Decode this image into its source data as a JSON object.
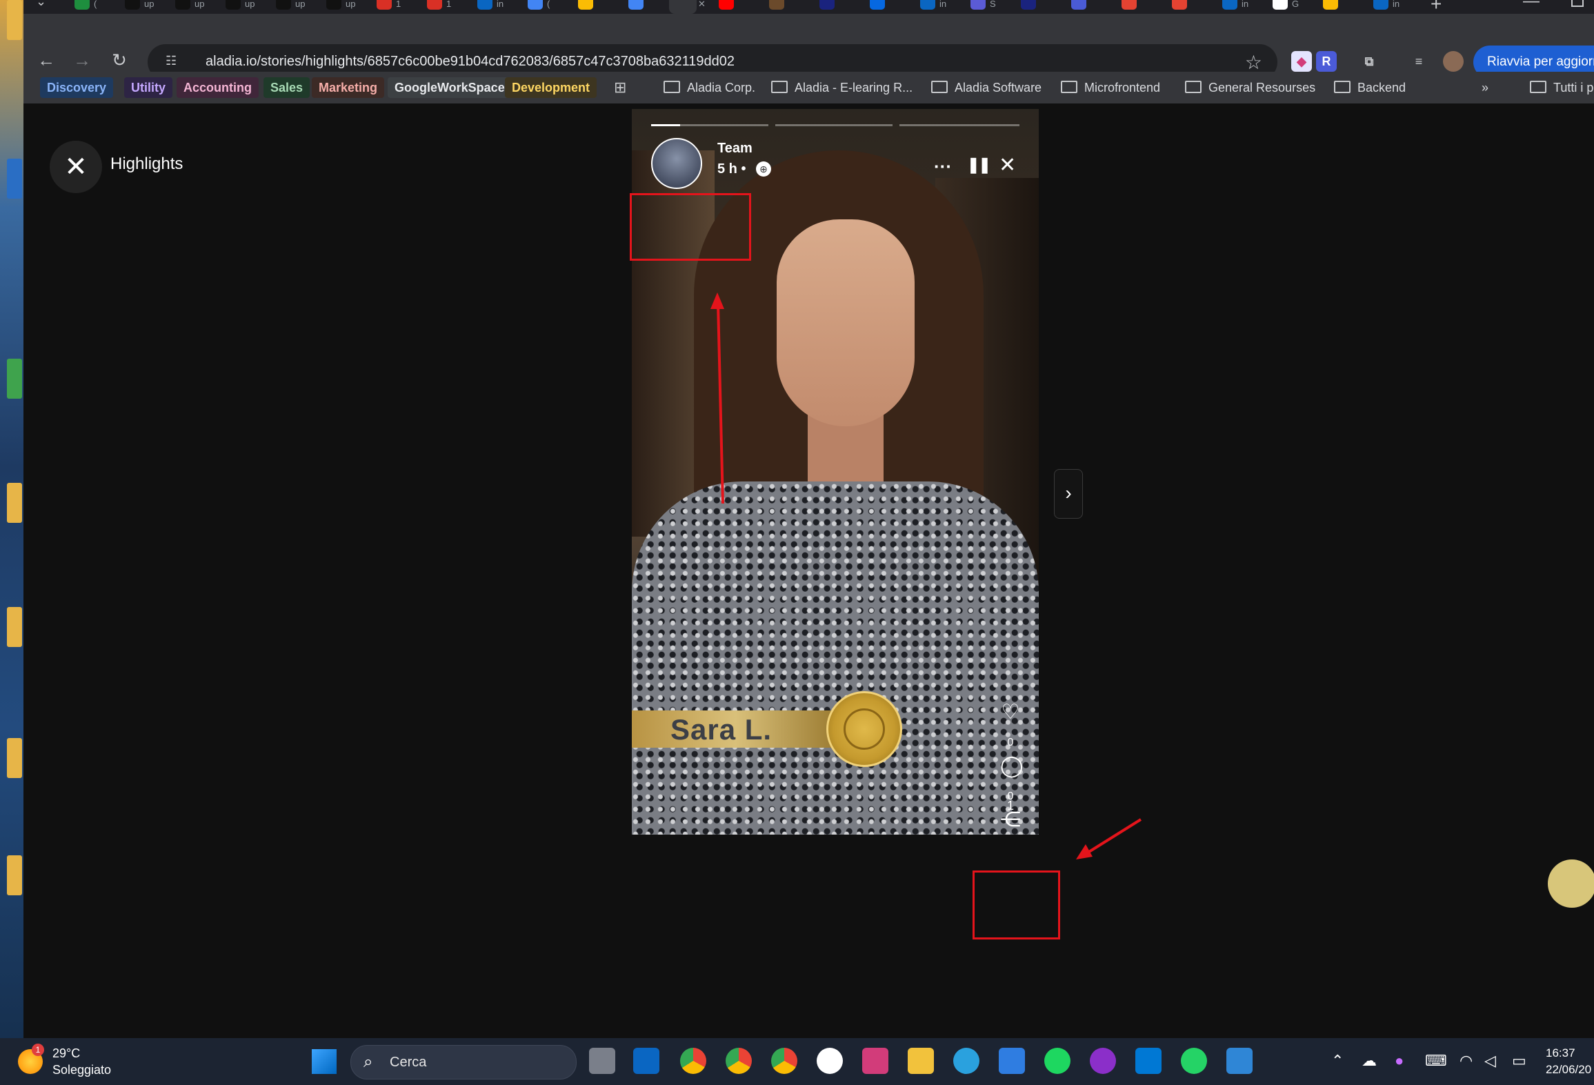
{
  "browser": {
    "url": "aladia.io/stories/highlights/6857c6c00be91b04cd762083/6857c47c3708ba632119dd02",
    "update_button": "Riavvia per aggiorn",
    "tabs": [
      {
        "icon": "google-meet-icon",
        "title": "(",
        "color": "#1e8e3e"
      },
      {
        "icon": "upwork-icon",
        "title": "up",
        "color": "#111111"
      },
      {
        "icon": "upwork-icon",
        "title": "up",
        "color": "#111111"
      },
      {
        "icon": "upwork-icon",
        "title": "up",
        "color": "#111111"
      },
      {
        "icon": "upwork-icon",
        "title": "up",
        "color": "#111111"
      },
      {
        "icon": "upwork-icon",
        "title": "up",
        "color": "#111111"
      },
      {
        "icon": "gmail-icon",
        "title": "1",
        "color": "#d93025"
      },
      {
        "icon": "gmail-icon",
        "title": "1",
        "color": "#d93025"
      },
      {
        "icon": "linkedin-icon",
        "title": "in",
        "color": "#0a66c2"
      },
      {
        "icon": "gemini-icon",
        "title": "(",
        "color": "#4285f4"
      },
      {
        "icon": "google-drive-icon",
        "title": "",
        "color": "#fbbc04"
      },
      {
        "icon": "google-docs-icon",
        "title": "",
        "color": "#4285f4"
      },
      {
        "icon": "active-tab-close-icon",
        "title": "✕",
        "color": "#35363a"
      },
      {
        "icon": "youtube-icon",
        "title": "",
        "color": "#ff0000"
      },
      {
        "icon": "site-icon",
        "title": "",
        "color": "#6b4a2b"
      },
      {
        "icon": "tab-icon",
        "title": "",
        "color": "#1a237e"
      },
      {
        "icon": "meta-icon",
        "title": "",
        "color": "#0668e1"
      },
      {
        "icon": "linkedin-icon",
        "title": "in",
        "color": "#0a66c2"
      },
      {
        "icon": "s-icon",
        "title": "S",
        "color": "#5b5bd6"
      },
      {
        "icon": "tab-icon",
        "title": "",
        "color": "#1a237e"
      },
      {
        "icon": "compass-icon",
        "title": "",
        "color": "#4a5bd6"
      },
      {
        "icon": "todoist-icon",
        "title": "",
        "color": "#e44332"
      },
      {
        "icon": "todoist-icon",
        "title": "",
        "color": "#e44332"
      },
      {
        "icon": "linkedin-icon",
        "title": "in",
        "color": "#0a66c2"
      },
      {
        "icon": "google-icon",
        "title": "G",
        "color": "#ffffff"
      },
      {
        "icon": "google-drive-icon",
        "title": "",
        "color": "#fbbc04"
      },
      {
        "icon": "linkedin-icon",
        "title": "in",
        "color": "#0a66c2"
      }
    ],
    "bookmark_chips": [
      {
        "label": "Discovery",
        "bg": "#1e3a5f",
        "fg": "#8ab4f8"
      },
      {
        "label": "Utility",
        "bg": "#2d2444",
        "fg": "#c5a8ff"
      },
      {
        "label": "Accounting",
        "bg": "#40263a",
        "fg": "#f4b5d4"
      },
      {
        "label": "Sales",
        "bg": "#1f3a2a",
        "fg": "#a8dab5"
      },
      {
        "label": "Marketing",
        "bg": "#3c2a26",
        "fg": "#f6aea9"
      },
      {
        "label": "GoogleWorkSpace",
        "bg": "#3c4043",
        "fg": "#e8eaed"
      },
      {
        "label": "Development",
        "bg": "#3d3520",
        "fg": "#fdd663"
      }
    ],
    "bookmark_folders": [
      "Aladia Corp.",
      "Aladia - E-learing R...",
      "Aladia Software",
      "Microfrontend",
      "General Resourses",
      "Backend"
    ],
    "all_bookmarks": "Tutti i p",
    "overflow": "»"
  },
  "page": {
    "title": "Highlights"
  },
  "story": {
    "user": "Team",
    "time": "5 h •",
    "name_caption": "Sara L.",
    "likes": "0",
    "comments": "0",
    "shares": "0",
    "index": "1"
  },
  "taskbar": {
    "temp": "29°C",
    "weather": "Soleggiato",
    "weather_badge": "1",
    "search": "Cerca",
    "time": "16:37",
    "date": "22/06/20"
  },
  "colors": {
    "annotation": "#e4141b",
    "update_button": "#1e5fd2"
  }
}
